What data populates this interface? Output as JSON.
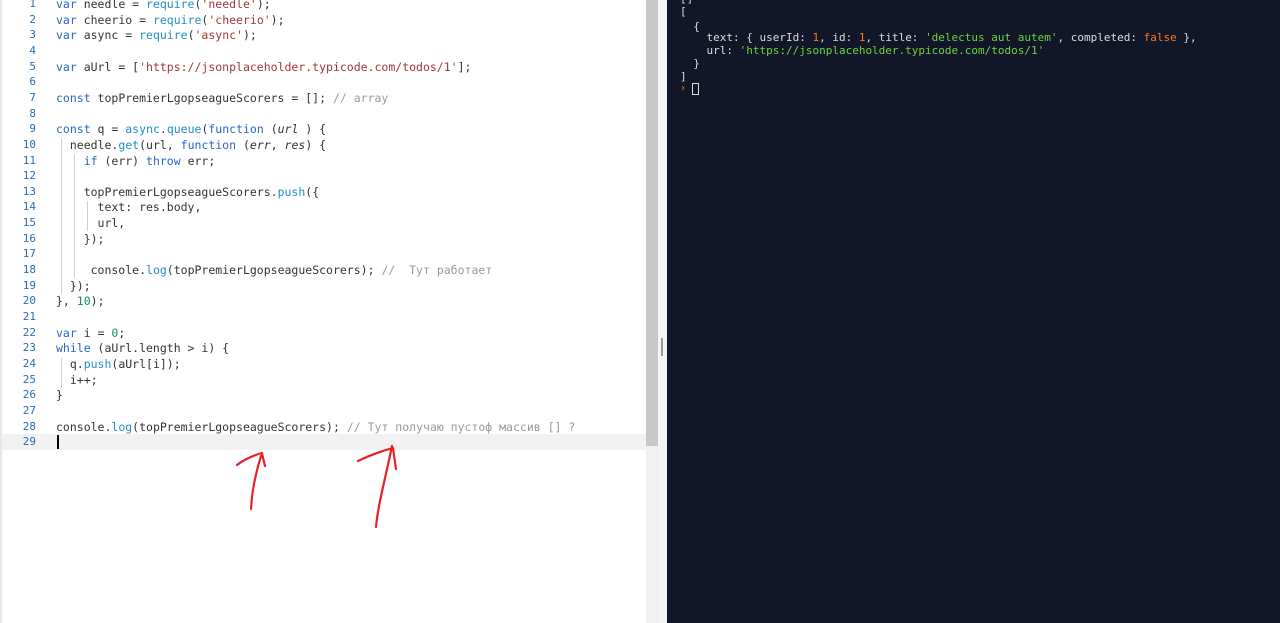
{
  "editor": {
    "lines": [
      {
        "n": "1",
        "t": [
          [
            "kw",
            "var "
          ],
          [
            "",
            "needle = "
          ],
          [
            "fn",
            "require"
          ],
          [
            "",
            "("
          ],
          [
            "str",
            "'needle'"
          ],
          [
            "",
            ");"
          ]
        ]
      },
      {
        "n": "2",
        "t": [
          [
            "kw",
            "var "
          ],
          [
            "",
            "cheerio = "
          ],
          [
            "fn",
            "require"
          ],
          [
            "",
            "("
          ],
          [
            "str",
            "'cheerio'"
          ],
          [
            "",
            ");"
          ]
        ]
      },
      {
        "n": "3",
        "t": [
          [
            "kw",
            "var "
          ],
          [
            "",
            "async = "
          ],
          [
            "fn",
            "require"
          ],
          [
            "",
            "("
          ],
          [
            "str",
            "'async'"
          ],
          [
            "",
            ");"
          ]
        ]
      },
      {
        "n": "4",
        "t": []
      },
      {
        "n": "5",
        "t": [
          [
            "kw",
            "var "
          ],
          [
            "",
            "aUrl = ["
          ],
          [
            "str",
            "'https://jsonplaceholder.typicode.com/todos/1'"
          ],
          [
            "",
            "];"
          ]
        ]
      },
      {
        "n": "6",
        "t": []
      },
      {
        "n": "7",
        "t": [
          [
            "kw",
            "const "
          ],
          [
            "",
            "topPremierLgopseagueScorers = []; "
          ],
          [
            "cmt",
            "// array"
          ]
        ]
      },
      {
        "n": "8",
        "t": []
      },
      {
        "n": "9",
        "t": [
          [
            "kw",
            "const "
          ],
          [
            "",
            "q = "
          ],
          [
            "fn",
            "async"
          ],
          [
            "",
            "."
          ],
          [
            "fn",
            "queue"
          ],
          [
            "",
            "("
          ],
          [
            "kw",
            "function "
          ],
          [
            "",
            "("
          ],
          [
            "it",
            "url"
          ],
          [
            "",
            " ) {"
          ]
        ]
      },
      {
        "n": "10",
        "t": [
          [
            "",
            "  needle."
          ],
          [
            "fn",
            "get"
          ],
          [
            "",
            "(url, "
          ],
          [
            "kw",
            "function "
          ],
          [
            "",
            "("
          ],
          [
            "it",
            "err"
          ],
          [
            "",
            ", "
          ],
          [
            "it",
            "res"
          ],
          [
            "",
            ") {"
          ]
        ]
      },
      {
        "n": "11",
        "t": [
          [
            "",
            "    "
          ],
          [
            "kw",
            "if "
          ],
          [
            "",
            "(err) "
          ],
          [
            "kw",
            "throw "
          ],
          [
            "",
            "err;"
          ]
        ]
      },
      {
        "n": "12",
        "t": []
      },
      {
        "n": "13",
        "t": [
          [
            "",
            "    topPremierLgopseagueScorers."
          ],
          [
            "fn",
            "push"
          ],
          [
            "",
            "({"
          ]
        ]
      },
      {
        "n": "14",
        "t": [
          [
            "",
            "      text: res.body,"
          ]
        ]
      },
      {
        "n": "15",
        "t": [
          [
            "",
            "      url,"
          ]
        ]
      },
      {
        "n": "16",
        "t": [
          [
            "",
            "    });"
          ]
        ]
      },
      {
        "n": "17",
        "t": []
      },
      {
        "n": "18",
        "t": [
          [
            "",
            "     console."
          ],
          [
            "fn",
            "log"
          ],
          [
            "",
            "(topPremierLgopseagueScorers); "
          ],
          [
            "cmt",
            "//  Тут работает"
          ]
        ]
      },
      {
        "n": "19",
        "t": [
          [
            "",
            "  });"
          ]
        ]
      },
      {
        "n": "20",
        "t": [
          [
            "",
            "}, "
          ],
          [
            "num",
            "10"
          ],
          [
            "",
            ");"
          ]
        ]
      },
      {
        "n": "21",
        "t": []
      },
      {
        "n": "22",
        "t": [
          [
            "kw",
            "var "
          ],
          [
            "",
            "i = "
          ],
          [
            "num",
            "0"
          ],
          [
            "",
            ";"
          ]
        ]
      },
      {
        "n": "23",
        "t": [
          [
            "kw",
            "while "
          ],
          [
            "",
            "(aUrl.length > i) {"
          ]
        ]
      },
      {
        "n": "24",
        "t": [
          [
            "",
            "  q."
          ],
          [
            "fn",
            "push"
          ],
          [
            "",
            "(aUrl[i]);"
          ]
        ]
      },
      {
        "n": "25",
        "t": [
          [
            "",
            "  i++;"
          ]
        ]
      },
      {
        "n": "26",
        "t": [
          [
            "",
            "}"
          ]
        ]
      },
      {
        "n": "27",
        "t": []
      },
      {
        "n": "28",
        "t": [
          [
            "",
            "console."
          ],
          [
            "fn",
            "log"
          ],
          [
            "",
            "(topPremierLgopseagueScorers); "
          ],
          [
            "cmt",
            "// Тут получаю пустоф массив [] ?"
          ]
        ]
      },
      {
        "n": "29",
        "t": []
      }
    ]
  },
  "console": {
    "line0": "[]",
    "open_bracket": "[",
    "open_brace": "  {",
    "text_key": "    text: { userId: ",
    "userId": "1",
    "id_key": ", id: ",
    "id": "1",
    "title_key": ", title: ",
    "title_val": "'delectus aut autem'",
    "completed_key": ", completed: ",
    "completed_val": "false",
    "close_inner": " },",
    "url_key": "    url: ",
    "url_val": "'https://jsonplaceholder.typicode.com/todos/1'",
    "close_brace": "  }",
    "close_bracket": "]",
    "prompt_symbol": "›"
  },
  "colors": {
    "editor_bg": "#ffffff",
    "console_bg": "#111628",
    "keyword": "#2b63c9",
    "string": "#a33636",
    "console_string": "#6ed33c",
    "console_number": "#ff7a1a",
    "annotation_arrow": "#e8202a"
  }
}
